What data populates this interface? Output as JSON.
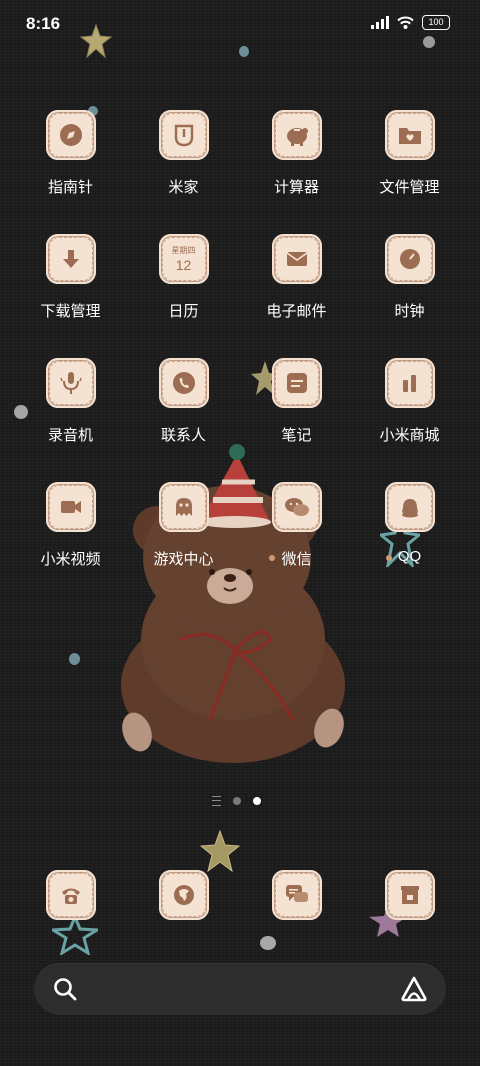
{
  "status_bar": {
    "time": "8:16",
    "battery": "100"
  },
  "apps": [
    {
      "label": "指南针",
      "icon": "compass-icon"
    },
    {
      "label": "米家",
      "icon": "mijia-icon"
    },
    {
      "label": "计算器",
      "icon": "calculator-icon"
    },
    {
      "label": "文件管理",
      "icon": "folder-icon"
    },
    {
      "label": "下载管理",
      "icon": "download-icon"
    },
    {
      "label": "日历",
      "icon": "calendar-icon",
      "week": "星期四",
      "day": "12"
    },
    {
      "label": "电子邮件",
      "icon": "mail-icon"
    },
    {
      "label": "时钟",
      "icon": "clock-icon"
    },
    {
      "label": "录音机",
      "icon": "microphone-icon"
    },
    {
      "label": "联系人",
      "icon": "phone-contact-icon"
    },
    {
      "label": "笔记",
      "icon": "notes-icon"
    },
    {
      "label": "小米商城",
      "icon": "store-icon"
    },
    {
      "label": "小米视频",
      "icon": "video-icon"
    },
    {
      "label": "游戏中心",
      "icon": "ghost-icon"
    },
    {
      "label": "微信",
      "icon": "wechat-icon"
    },
    {
      "label": "QQ",
      "icon": "qq-icon"
    }
  ],
  "dock": [
    {
      "icon": "phone-icon"
    },
    {
      "icon": "browser-icon"
    },
    {
      "icon": "messages-icon"
    },
    {
      "icon": "app-store-icon"
    }
  ],
  "colors": {
    "icon_bg": "#f4e3d2",
    "icon_glyph": "#9c6d52",
    "background": "#1b1b1c"
  }
}
